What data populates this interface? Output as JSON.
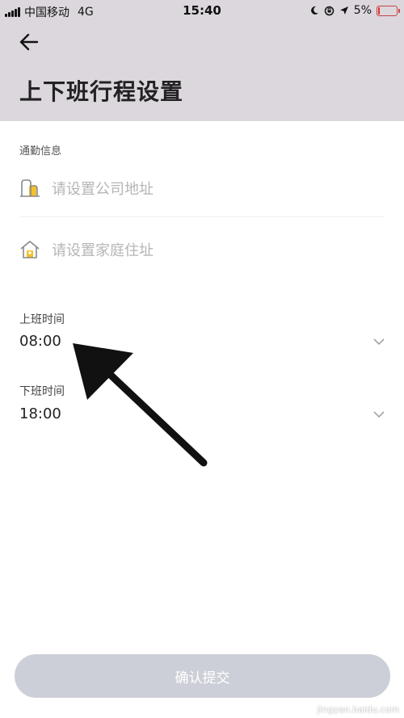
{
  "status_bar": {
    "carrier": "中国移动",
    "network": "4G",
    "time": "15:40",
    "battery": "5%"
  },
  "header": {
    "title": "上下班行程设置"
  },
  "commute": {
    "section_label": "通勤信息",
    "company_placeholder": "请设置公司地址",
    "home_placeholder": "请设置家庭住址"
  },
  "work_start": {
    "label": "上班时间",
    "value": "08:00"
  },
  "work_end": {
    "label": "下班时间",
    "value": "18:00"
  },
  "footer": {
    "submit_label": "确认提交"
  },
  "watermark": {
    "text": "jingyan.baidu.com"
  },
  "colors": {
    "header_bg": "#dcd7dd",
    "icon_accent": "#f2c12e",
    "button_bg": "#cdcfd8"
  }
}
